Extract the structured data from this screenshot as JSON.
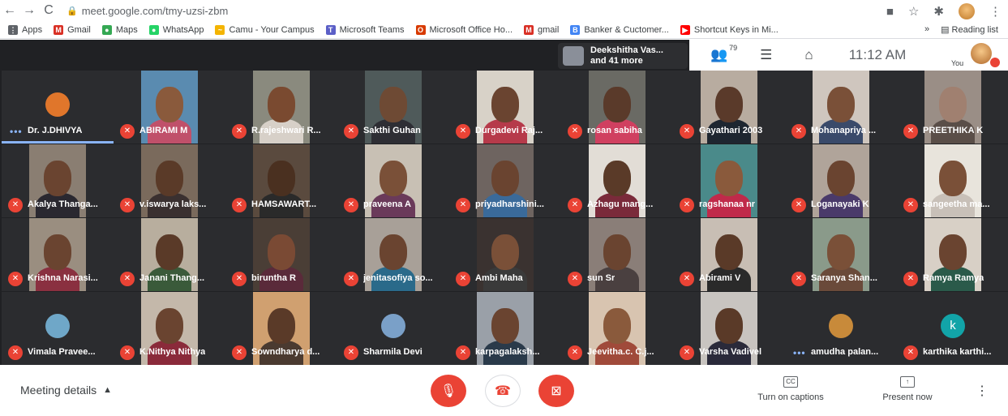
{
  "browser": {
    "url": "meet.google.com/tmy-uzsi-zbm",
    "nav": {
      "back": "←",
      "forward": "→",
      "reload": "C"
    },
    "bookmarks": [
      {
        "label": "Apps",
        "color": "#5f6368",
        "icon": "apps-grid-icon",
        "glyph": "⋮"
      },
      {
        "label": "Gmail",
        "color": "#d93025",
        "icon": "gmail-icon",
        "glyph": "M"
      },
      {
        "label": "Maps",
        "color": "#34a853",
        "icon": "maps-pin-icon",
        "glyph": "●"
      },
      {
        "label": "WhatsApp",
        "color": "#25d366",
        "icon": "whatsapp-icon",
        "glyph": "●"
      },
      {
        "label": "Camu - Your Campus",
        "color": "#f4b400",
        "icon": "camu-icon",
        "glyph": "~"
      },
      {
        "label": "Microsoft Teams",
        "color": "#5b5fc7",
        "icon": "teams-icon",
        "glyph": "T"
      },
      {
        "label": "Microsoft Office Ho...",
        "color": "#d83b01",
        "icon": "office-icon",
        "glyph": "O"
      },
      {
        "label": "gmail",
        "color": "#d93025",
        "icon": "gmail-icon",
        "glyph": "M"
      },
      {
        "label": "Banker & Cuctomer...",
        "color": "#4285f4",
        "icon": "bank-icon",
        "glyph": "B"
      },
      {
        "label": "Shortcut Keys in Mi...",
        "color": "#ff0000",
        "icon": "youtube-icon",
        "glyph": "▶"
      }
    ],
    "more_bookmarks": "»",
    "reading_list": "Reading list"
  },
  "meet": {
    "pinned": {
      "line1": "Deekshitha Vas...",
      "line2": "and 41 more"
    },
    "participants_count": "79",
    "time": "11:12 AM",
    "you_label": "You",
    "tiles": [
      {
        "name": "Dr. J.DHIVYA",
        "mode": "avatar",
        "bg": "#2b2c2f",
        "avatar": "#e0762b",
        "muted": false,
        "active": true
      },
      {
        "name": "ABIRAMI M",
        "mode": "video",
        "bg": "#5a8bb0",
        "skin": "#8a5a3c",
        "cloth": "#c0506a",
        "muted": true
      },
      {
        "name": "R.rajeshwari R...",
        "mode": "video",
        "bg": "#8a8a7e",
        "skin": "#7a4a30",
        "cloth": "#d7d0c8",
        "muted": true
      },
      {
        "name": "Sakthi Guhan",
        "mode": "video",
        "bg": "#4f5a5a",
        "skin": "#6e4a34",
        "cloth": "#2e2e34",
        "muted": true
      },
      {
        "name": "Durgadevi Raj...",
        "mode": "video",
        "bg": "#d8d2c8",
        "skin": "#6a4430",
        "cloth": "#b63a4a",
        "muted": true
      },
      {
        "name": "rosan sabiha",
        "mode": "video",
        "bg": "#6a6a64",
        "skin": "#5a3a2a",
        "cloth": "#d04060",
        "muted": true
      },
      {
        "name": "Gayathari 2003",
        "mode": "video",
        "bg": "#b8aca0",
        "skin": "#5a3a2a",
        "cloth": "#1e2630",
        "muted": true
      },
      {
        "name": "Mohanapriya ...",
        "mode": "video",
        "bg": "#cfc6be",
        "skin": "#7a5038",
        "cloth": "#3a4a6a",
        "muted": true
      },
      {
        "name": "PREETHIKA K",
        "mode": "video",
        "bg": "#9a8e86",
        "skin": "#a08070",
        "cloth": "#5a4e48",
        "muted": true
      },
      {
        "name": "Akalya Thanga...",
        "mode": "video",
        "bg": "#8a7e72",
        "skin": "#6a4430",
        "cloth": "#2a2830",
        "muted": true
      },
      {
        "name": "v.iswarya laks...",
        "mode": "video",
        "bg": "#7a6a5c",
        "skin": "#5a3a28",
        "cloth": "#3a3030",
        "muted": true
      },
      {
        "name": "HAMSAWART...",
        "mode": "video",
        "bg": "#5a4a3e",
        "skin": "#4a3020",
        "cloth": "#2a2a2a",
        "muted": true
      },
      {
        "name": "praveena A",
        "mode": "video",
        "bg": "#c8c0b4",
        "skin": "#7a5038",
        "cloth": "#6a3a5a",
        "muted": true
      },
      {
        "name": "priyadharshini...",
        "mode": "video",
        "bg": "#6e6460",
        "skin": "#6a4430",
        "cloth": "#3a6a9a",
        "muted": true
      },
      {
        "name": "Azhagu mang...",
        "mode": "video",
        "bg": "#e2ddd6",
        "skin": "#5a3a28",
        "cloth": "#7a2a3a",
        "muted": true
      },
      {
        "name": "ragshanaa nr",
        "mode": "video",
        "bg": "#4a8a8a",
        "skin": "#8a5a3c",
        "cloth": "#c02a4a",
        "muted": true
      },
      {
        "name": "Loganayaki K",
        "mode": "video",
        "bg": "#b0a49a",
        "skin": "#6a4430",
        "cloth": "#4a3a6a",
        "muted": true
      },
      {
        "name": "sangeetha ma...",
        "mode": "video",
        "bg": "#e8e4dc",
        "skin": "#7a5038",
        "cloth": "#c8c0b8",
        "muted": true
      },
      {
        "name": "Krishna Narasi...",
        "mode": "video",
        "bg": "#9a8e80",
        "skin": "#6a4430",
        "cloth": "#8a3040",
        "muted": true
      },
      {
        "name": "Janani Thang...",
        "mode": "video",
        "bg": "#b8ae9e",
        "skin": "#5a3a28",
        "cloth": "#3a5a3a",
        "muted": true
      },
      {
        "name": "biruntha R",
        "mode": "video",
        "bg": "#4a3e36",
        "skin": "#7a4a34",
        "cloth": "#5a2a3a",
        "muted": true
      },
      {
        "name": "jenitasofiya so...",
        "mode": "video",
        "bg": "#a8a098",
        "skin": "#6a4430",
        "cloth": "#2a6a8a",
        "muted": true
      },
      {
        "name": "Ambi Maha",
        "mode": "video",
        "bg": "#3a3230",
        "skin": "#7a5038",
        "cloth": "#3a3a3a",
        "muted": true
      },
      {
        "name": "sun Sr",
        "mode": "video",
        "bg": "#8a7e78",
        "skin": "#6a4430",
        "cloth": "#4a4040",
        "muted": true
      },
      {
        "name": "Abirami V",
        "mode": "video",
        "bg": "#c8beb4",
        "skin": "#5a3a28",
        "cloth": "#2a2a2a",
        "muted": true
      },
      {
        "name": "Saranya Shan...",
        "mode": "video",
        "bg": "#8a9a8a",
        "skin": "#7a5038",
        "cloth": "#6a4a3a",
        "muted": true
      },
      {
        "name": "Ramya Ramya",
        "mode": "video",
        "bg": "#d8d0c6",
        "skin": "#6a4430",
        "cloth": "#2a5a4a",
        "muted": true
      },
      {
        "name": "Vimala Pravee...",
        "mode": "avatar",
        "bg": "#2b2c2f",
        "avatar": "#6fa7c8",
        "muted": true
      },
      {
        "name": "K.Nithya Nithya",
        "mode": "video",
        "bg": "#c4b8aa",
        "skin": "#6a4430",
        "cloth": "#8a2a3a",
        "muted": true
      },
      {
        "name": "Sowndharya d...",
        "mode": "video",
        "bg": "#d0a070",
        "skin": "#5a3a28",
        "cloth": "#4a3a30",
        "muted": true
      },
      {
        "name": "Sharmila Devi",
        "mode": "avatar",
        "bg": "#2b2c2f",
        "avatar": "#7aa0c8",
        "muted": true
      },
      {
        "name": "karpagalaksh...",
        "mode": "video",
        "bg": "#9aa0a8",
        "skin": "#6a4430",
        "cloth": "#2a3a4a",
        "muted": true
      },
      {
        "name": "Jeevitha.c. C.j...",
        "mode": "video",
        "bg": "#d8c4b0",
        "skin": "#8a5a3c",
        "cloth": "#a04a3a",
        "muted": true
      },
      {
        "name": "Varsha Vadivel",
        "mode": "video",
        "bg": "#c8c4c0",
        "skin": "#5a3a28",
        "cloth": "#2a2a3a",
        "muted": true
      },
      {
        "name": "amudha palan...",
        "mode": "avatar",
        "bg": "#2b2c2f",
        "avatar": "#c88a3a",
        "muted": false
      },
      {
        "name": "karthika karthi...",
        "mode": "letter",
        "bg": "#2b2c2f",
        "letter": "k",
        "muted": true
      }
    ]
  },
  "controls": {
    "meeting_details": "Meeting details",
    "captions": "Turn on captions",
    "captions_icon_text": "CC",
    "present": "Present now",
    "more": "⋮"
  }
}
